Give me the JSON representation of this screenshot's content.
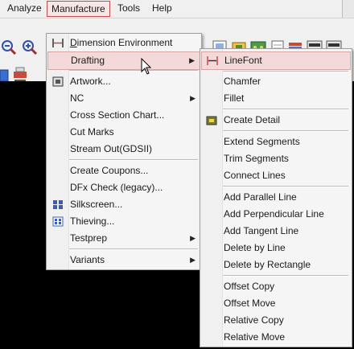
{
  "menubar": {
    "items": [
      {
        "label": "Analyze"
      },
      {
        "label": "Manufacture"
      },
      {
        "label": "Tools"
      },
      {
        "label": "Help"
      }
    ]
  },
  "manufacture_menu": {
    "items": [
      {
        "label": "Dimension Environment",
        "icon": "dimension-icon"
      },
      {
        "label": "Drafting",
        "submenu": true
      },
      {
        "label": "Artwork...",
        "icon": "artwork-icon"
      },
      {
        "label": "NC",
        "submenu": true
      },
      {
        "label": "Cross Section Chart..."
      },
      {
        "label": "Cut Marks"
      },
      {
        "label": "Stream Out(GDSII)"
      },
      {
        "label": "Create Coupons..."
      },
      {
        "label": "DFx Check (legacy)..."
      },
      {
        "label": "Silkscreen...",
        "icon": "silkscreen-icon"
      },
      {
        "label": "Thieving...",
        "icon": "thieving-icon"
      },
      {
        "label": "Testprep",
        "submenu": true
      },
      {
        "label": "Variants",
        "submenu": true
      }
    ]
  },
  "drafting_menu": {
    "items": [
      {
        "label": "LineFont",
        "icon": "linefont-icon"
      },
      {
        "label": "Chamfer"
      },
      {
        "label": "Fillet"
      },
      {
        "label": "Create Detail",
        "icon": "create-detail-icon"
      },
      {
        "label": "Extend Segments"
      },
      {
        "label": "Trim Segments"
      },
      {
        "label": "Connect Lines"
      },
      {
        "label": "Add Parallel Line"
      },
      {
        "label": "Add Perpendicular Line"
      },
      {
        "label": "Add Tangent Line"
      },
      {
        "label": "Delete by Line"
      },
      {
        "label": "Delete by Rectangle"
      },
      {
        "label": "Offset Copy"
      },
      {
        "label": "Offset Move"
      },
      {
        "label": "Relative Copy"
      },
      {
        "label": "Relative Move"
      }
    ]
  },
  "colors": {
    "highlight": "#f3d9d9",
    "menubar_active_border": "#c24a4a",
    "canvas": "#000000"
  }
}
